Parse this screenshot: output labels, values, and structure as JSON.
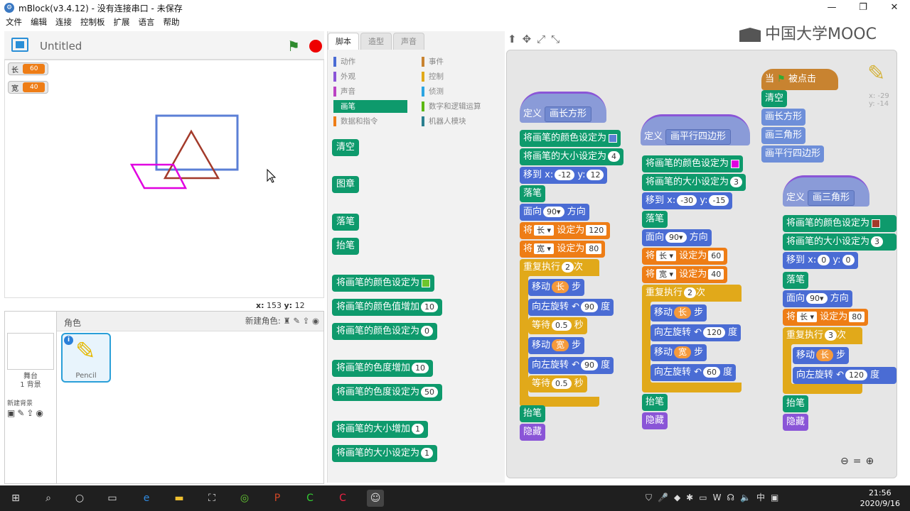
{
  "window": {
    "title": "mBlock(v3.4.12) - 没有连接串口 - 未保存",
    "min": "—",
    "max": "❐",
    "close": "✕"
  },
  "menu": [
    "文件",
    "编辑",
    "连接",
    "控制板",
    "扩展",
    "语言",
    "帮助"
  ],
  "stage": {
    "project_title": "Untitled",
    "variables": [
      {
        "name": "长",
        "value": "60"
      },
      {
        "name": "宽",
        "value": "40"
      }
    ],
    "coords": {
      "x_label": "x:",
      "x": "153",
      "y_label": "y:",
      "y": "12"
    }
  },
  "sprites": {
    "header_label": "角色",
    "new_sprite_label": "新建角色:",
    "stage_label_1": "舞台",
    "stage_label_2": "1 背景",
    "new_bg_label": "新建背景",
    "sprite_name": "Pencil"
  },
  "palette": {
    "tabs": [
      "脚本",
      "造型",
      "声音"
    ],
    "categories_left": [
      "动作",
      "外观",
      "声音",
      "画笔",
      "数据和指令"
    ],
    "categories_right": [
      "事件",
      "控制",
      "侦测",
      "数字和逻辑运算",
      "机器人模块"
    ],
    "blocks": {
      "clear": "清空",
      "stamp": "图章",
      "pen_down": "落笔",
      "pen_up": "抬笔",
      "set_color": "将画笔的颜色设定为",
      "change_color_by": "将画笔的颜色值增加",
      "change_color_by_val": "10",
      "set_color_to": "将画笔的颜色设定为",
      "set_color_to_val": "0",
      "change_shade": "将画笔的色度增加",
      "change_shade_val": "10",
      "set_shade": "将画笔的色度设定为",
      "set_shade_val": "50",
      "change_size": "将画笔的大小增加",
      "change_size_val": "1",
      "set_size": "将画笔的大小设定为",
      "set_size_val": "1"
    }
  },
  "scripts": {
    "rect": {
      "define": "定义",
      "name": "画长方形",
      "set_color": "将画笔的颜色设定为",
      "set_size": "将画笔的大小设定为",
      "size": "4",
      "goto": "移到 x:",
      "x": "-12",
      "y_label": "y:",
      "y": "12",
      "pen_down": "落笔",
      "point": "面向",
      "dir": "90▾",
      "dir_suffix": "方向",
      "set1": "将",
      "var1": "长 ▾",
      "set_to": "设定为",
      "val1": "120",
      "set2": "将",
      "var2": "宽 ▾",
      "val2": "80",
      "repeat": "重复执行",
      "times": "2",
      "times_suffix": "次",
      "move": "移动",
      "steps": "步",
      "len_var": "长",
      "wid_var": "宽",
      "turn": "向左旋转 ↶",
      "deg": "90",
      "deg_suffix": "度",
      "wait": "等待",
      "wait_val": "0.5",
      "wait_suffix": "秒",
      "pen_up": "抬笔",
      "hide": "隐藏"
    },
    "para": {
      "define": "定义",
      "name": "画平行四边形",
      "set_color": "将画笔的颜色设定为",
      "set_size": "将画笔的大小设定为",
      "size": "3",
      "goto": "移到 x:",
      "x": "-30",
      "y_label": "y:",
      "y": "-15",
      "pen_down": "落笔",
      "point": "面向",
      "dir": "90▾",
      "dir_suffix": "方向",
      "set1": "将",
      "var1": "长 ▾",
      "set_to": "设定为",
      "val1": "60",
      "set2": "将",
      "var2": "宽 ▾",
      "val2": "40",
      "repeat": "重复执行",
      "times": "2",
      "times_suffix": "次",
      "move": "移动",
      "steps": "步",
      "len_var": "长",
      "wid_var": "宽",
      "turn": "向左旋转 ↶",
      "deg1": "120",
      "deg2": "60",
      "deg_suffix": "度",
      "pen_up": "抬笔",
      "hide": "隐藏"
    },
    "main": {
      "when": "当",
      "clicked": "被点击",
      "clear": "清空",
      "c1": "画长方形",
      "c2": "画三角形",
      "c3": "画平行四边形"
    },
    "tri": {
      "define": "定义",
      "name": "画三角形",
      "set_color": "将画笔的颜色设定为",
      "set_size": "将画笔的大小设定为",
      "size": "3",
      "goto": "移到 x:",
      "x": "0",
      "y_label": "y:",
      "y": "0",
      "pen_down": "落笔",
      "point": "面向",
      "dir": "90▾",
      "dir_suffix": "方向",
      "set1": "将",
      "var1": "长 ▾",
      "set_to": "设定为",
      "val1": "80",
      "repeat": "重复执行",
      "times": "3",
      "times_suffix": "次",
      "move": "移动",
      "steps": "步",
      "len_var": "长",
      "turn": "向左旋转 ↶",
      "deg": "120",
      "deg_suffix": "度",
      "pen_up": "抬笔",
      "hide": "隐藏"
    },
    "sprite_xy": {
      "x": "x: -29",
      "y": "y: -14"
    }
  },
  "logo": "中国大学MOOC",
  "taskbar": {
    "time": "21:56",
    "date": "2020/9/16",
    "ime": "中"
  },
  "colors": {
    "pen": "#0e9a6c",
    "motion": "#4a6cd4",
    "control": "#e1a91a",
    "data": "#ee7d16",
    "looks": "#8a55d7",
    "custom": "#6e8fd9",
    "rect_color": "#5b7fd6",
    "para_color": "#e000e0",
    "tri_color": "#a33a2a"
  }
}
